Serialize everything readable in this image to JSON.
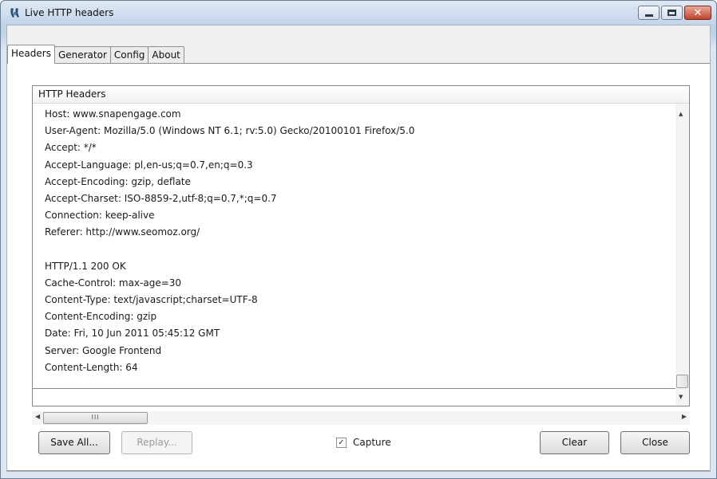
{
  "window": {
    "title": "Live HTTP headers"
  },
  "tabs": [
    {
      "label": "Headers",
      "active": true
    },
    {
      "label": "Generator",
      "active": false
    },
    {
      "label": "Config",
      "active": false
    },
    {
      "label": "About",
      "active": false
    }
  ],
  "headers_panel": {
    "column_header": "HTTP Headers",
    "lines": [
      "Host: www.snapengage.com",
      "User-Agent: Mozilla/5.0 (Windows NT 6.1; rv:5.0) Gecko/20100101 Firefox/5.0",
      "Accept: */*",
      "Accept-Language: pl,en-us;q=0.7,en;q=0.3",
      "Accept-Encoding: gzip, deflate",
      "Accept-Charset: ISO-8859-2,utf-8;q=0.7,*;q=0.7",
      "Connection: keep-alive",
      "Referer: http://www.seomoz.org/",
      "",
      "HTTP/1.1 200 OK",
      "Cache-Control: max-age=30",
      "Content-Type: text/javascript;charset=UTF-8",
      "Content-Encoding: gzip",
      "Date: Fri, 10 Jun 2011 05:45:12 GMT",
      "Server: Google Frontend",
      "Content-Length: 64"
    ]
  },
  "hscroll_thumb_grip": "III",
  "buttons": {
    "save_all": "Save All...",
    "replay": "Replay...",
    "clear": "Clear",
    "close": "Close"
  },
  "capture": {
    "label": "Capture",
    "checked": true
  },
  "icons": {
    "app": "live-http-headers-icon",
    "minimize": "minimize-icon",
    "maximize": "maximize-icon",
    "close": "close-icon"
  },
  "colors": {
    "titlebar": "#c3d4ea",
    "close_button": "#c1432c"
  }
}
